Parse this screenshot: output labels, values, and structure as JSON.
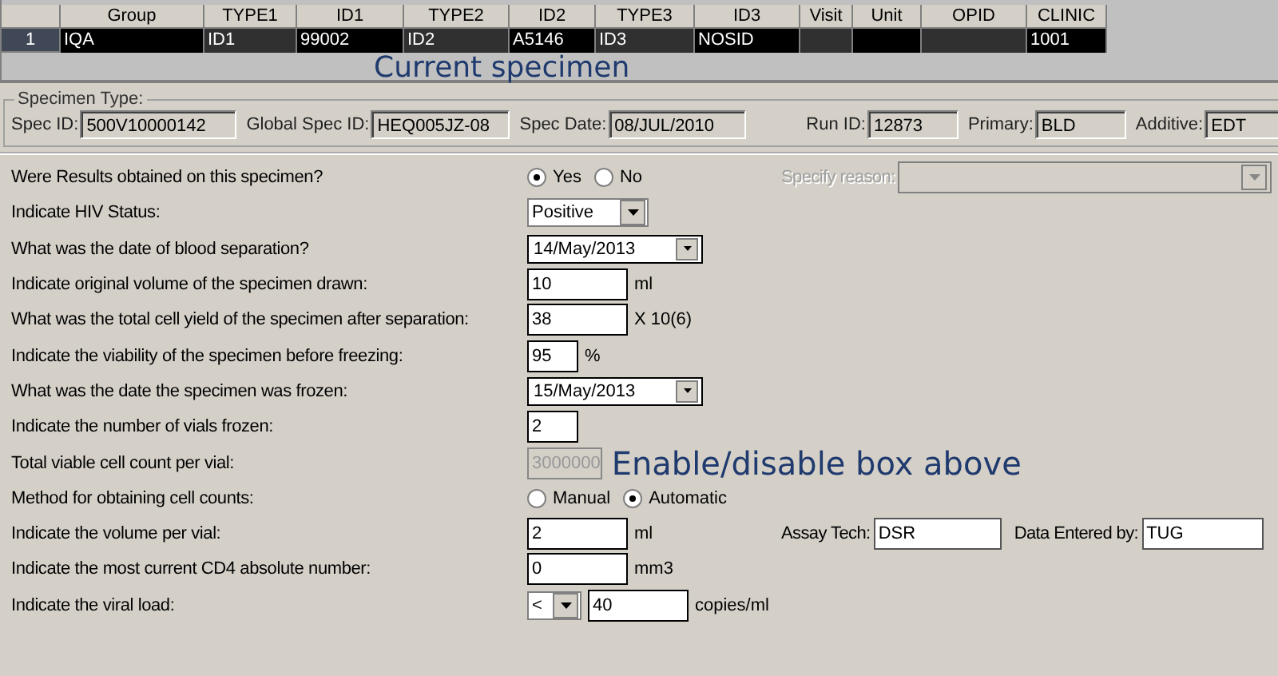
{
  "grid": {
    "columns": [
      "Group",
      "TYPE1",
      "ID1",
      "TYPE2",
      "ID2",
      "TYPE3",
      "ID3",
      "Visit",
      "Unit",
      "OPID",
      "CLINIC"
    ],
    "annotation": "Current specimen",
    "rows": [
      {
        "number": "1",
        "selected": true,
        "cells": [
          "IQA",
          "ID1",
          "99002",
          "ID2",
          "A5146",
          "ID3",
          "NOSID",
          "",
          "",
          "",
          "1001"
        ]
      }
    ]
  },
  "specimen": {
    "title": "Specimen Type:",
    "fields": [
      {
        "label": "Spec ID:",
        "value": "500V10000142"
      },
      {
        "label": "Global Spec ID:",
        "value": "HEQ005JZ-08"
      },
      {
        "label": "Spec Date:",
        "value": "08/JUL/2010"
      },
      {
        "label": "Run ID:",
        "value": "12873"
      },
      {
        "label": "Primary:",
        "value": "BLD"
      },
      {
        "label": "Additive:",
        "value": "EDT"
      }
    ]
  },
  "questions": [
    {
      "label": "Were Results obtained on this specimen?",
      "kind": "radio",
      "options": [
        {
          "label": "Yes",
          "selected": true
        },
        {
          "label": "No",
          "selected": false
        }
      ],
      "side": [
        {
          "kind": "combo",
          "label": "Specify reason:",
          "disabled": true
        }
      ]
    },
    {
      "label": "Indicate HIV Status:",
      "kind": "select",
      "value": "Positive"
    },
    {
      "label": "What was the date of blood separation?",
      "kind": "date",
      "value": "14/May/2013"
    },
    {
      "label": "Indicate original volume of the specimen drawn:",
      "kind": "input",
      "value": "10",
      "unit": "ml"
    },
    {
      "label": "What was the total cell yield of the specimen after separation:",
      "kind": "input",
      "value": "38",
      "unit": "X 10(6)"
    },
    {
      "label": "Indicate the viability of the specimen before freezing:",
      "kind": "small-input",
      "value": "95",
      "unit": "%"
    },
    {
      "label": "What was the date the specimen was frozen:",
      "kind": "date",
      "value": "15/May/2013"
    },
    {
      "label": "Indicate the number of vials frozen:",
      "kind": "small-input",
      "value": "2"
    },
    {
      "label": "Total viable cell count per vial:",
      "kind": "input",
      "value": "3000000",
      "disabled": true,
      "annotation": "Enable/disable box above"
    },
    {
      "label": "Method for obtaining cell counts:",
      "kind": "radio",
      "options": [
        {
          "label": "Manual",
          "selected": false
        },
        {
          "label": "Automatic",
          "selected": true
        }
      ]
    },
    {
      "label": "Indicate the volume per vial:",
      "kind": "input",
      "value": "2",
      "unit": "ml",
      "side": [
        {
          "kind": "field",
          "label": "Assay Tech:",
          "value": "DSR"
        },
        {
          "kind": "field",
          "label": "Data Entered by:",
          "value": "TUG"
        }
      ]
    },
    {
      "label": "Indicate the most current CD4 absolute number:",
      "kind": "input",
      "value": "0",
      "unit": "mm3"
    },
    {
      "label": "Indicate the viral load:",
      "kind": "select-input",
      "select": "<",
      "value": "40",
      "unit": "copies/ml"
    }
  ]
}
